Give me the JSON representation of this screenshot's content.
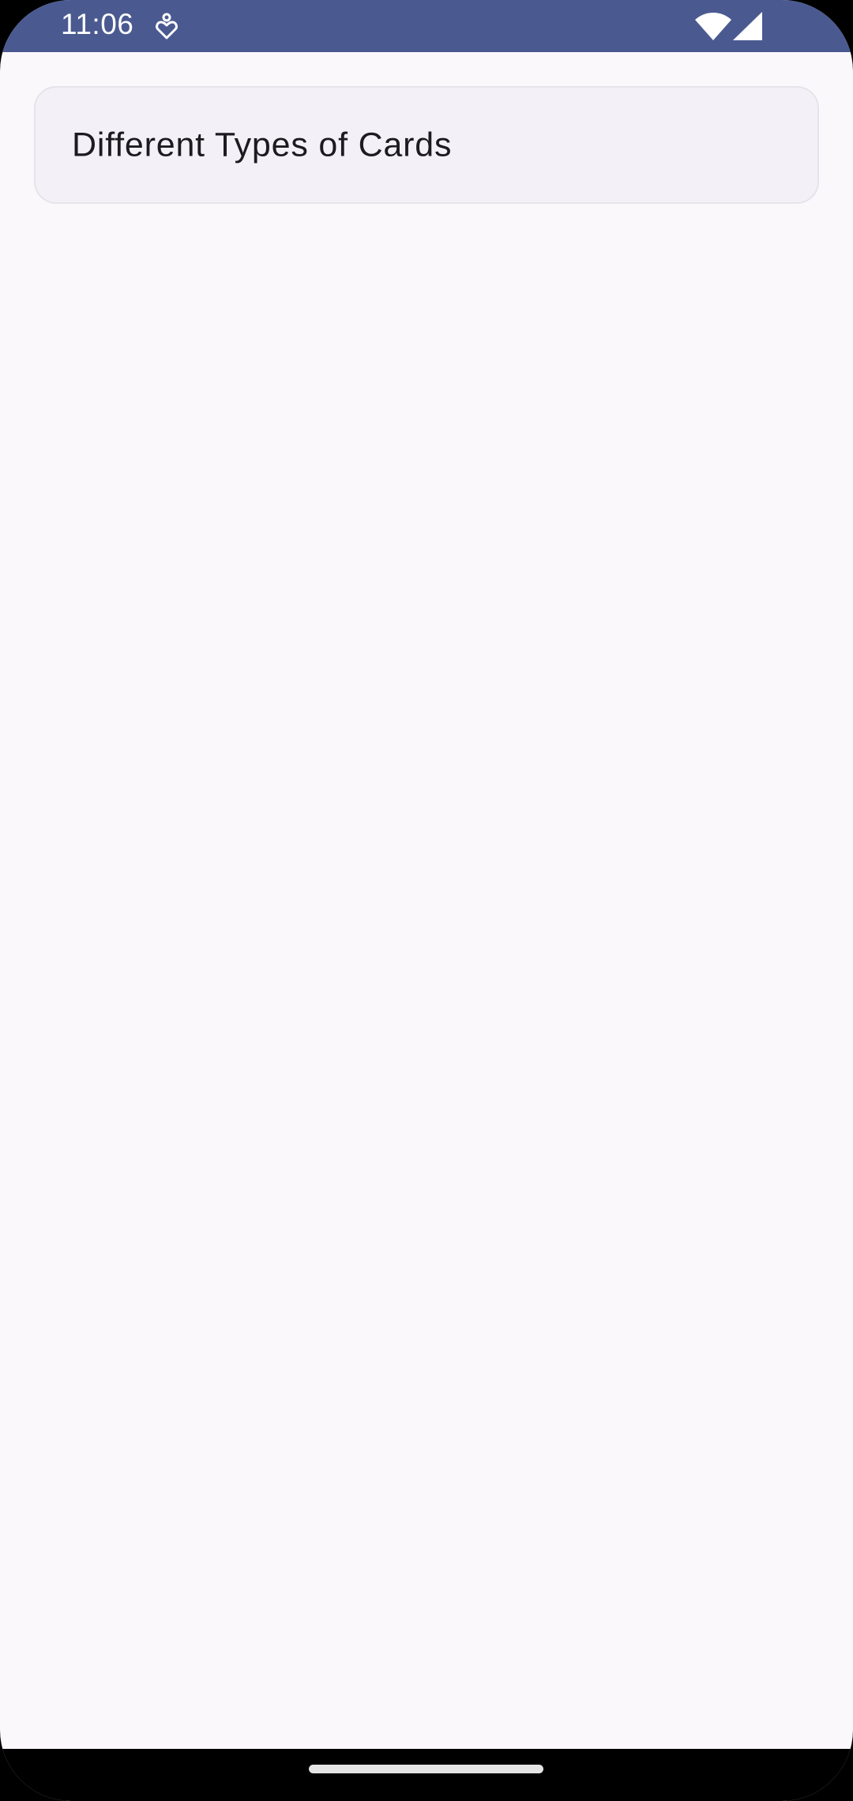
{
  "status_bar": {
    "time": "11:06",
    "notification_icon": "download-heart-icon",
    "wifi_icon": "wifi-icon",
    "signal_icon": "cellular-signal-icon",
    "background_color": "#4A5A91"
  },
  "main": {
    "background_color": "#FBF8FC",
    "card": {
      "title": "Different Types of Cards",
      "background_color": "#F3F1F7"
    }
  },
  "nav_bar": {
    "home_handle": "gesture-home-handle"
  }
}
